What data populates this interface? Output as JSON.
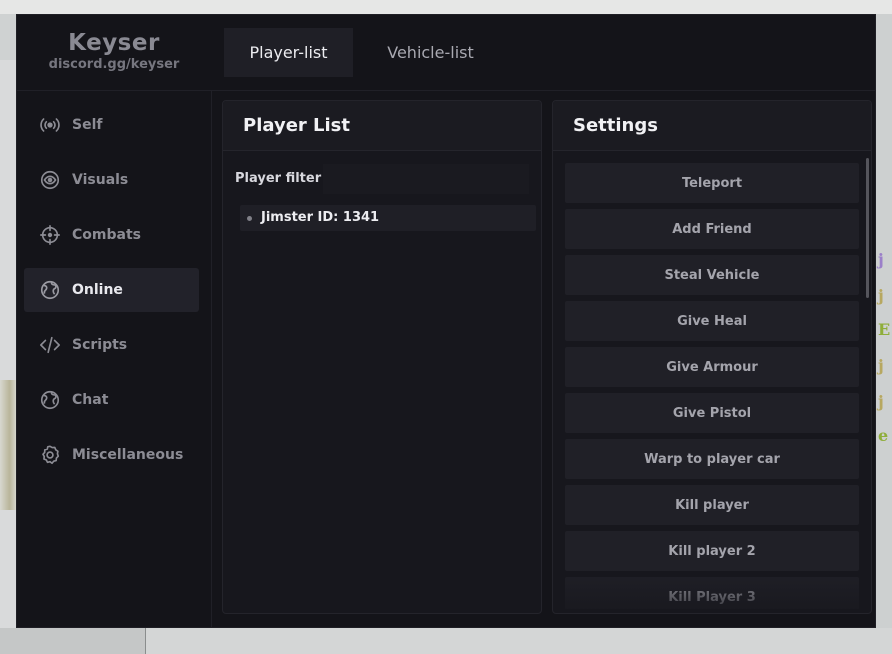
{
  "brand": {
    "title": "Keyser",
    "subtitle": "discord.gg/keyser"
  },
  "tabs": [
    {
      "label": "Player-list",
      "active": true
    },
    {
      "label": "Vehicle-list",
      "active": false
    }
  ],
  "sidebar": {
    "items": [
      {
        "label": "Self",
        "icon": "broadcast-icon"
      },
      {
        "label": "Visuals",
        "icon": "eye-icon"
      },
      {
        "label": "Combats",
        "icon": "crosshair-icon"
      },
      {
        "label": "Online",
        "icon": "globe-icon",
        "active": true
      },
      {
        "label": "Scripts",
        "icon": "code-icon"
      },
      {
        "label": "Chat",
        "icon": "globe-icon"
      },
      {
        "label": "Miscellaneous",
        "icon": "gear-icon"
      }
    ]
  },
  "player_panel": {
    "title": "Player List",
    "filter_label": "Player filter",
    "filter_value": "",
    "players": [
      {
        "label": "Jimster ID: 1341"
      }
    ]
  },
  "settings_panel": {
    "title": "Settings",
    "actions": [
      "Teleport",
      "Add Friend",
      "Steal Vehicle",
      "Give Heal",
      "Give Armour",
      "Give Pistol",
      "Warp to player car",
      "Kill player",
      "Kill player 2",
      "Kill Player 3"
    ]
  },
  "colors": {
    "window_bg": "#141419",
    "panel_bg": "#17171d",
    "button_bg": "#202027",
    "active_item_bg": "#22222a",
    "text_primary": "#ededf1",
    "text_muted": "#8c8c94"
  }
}
